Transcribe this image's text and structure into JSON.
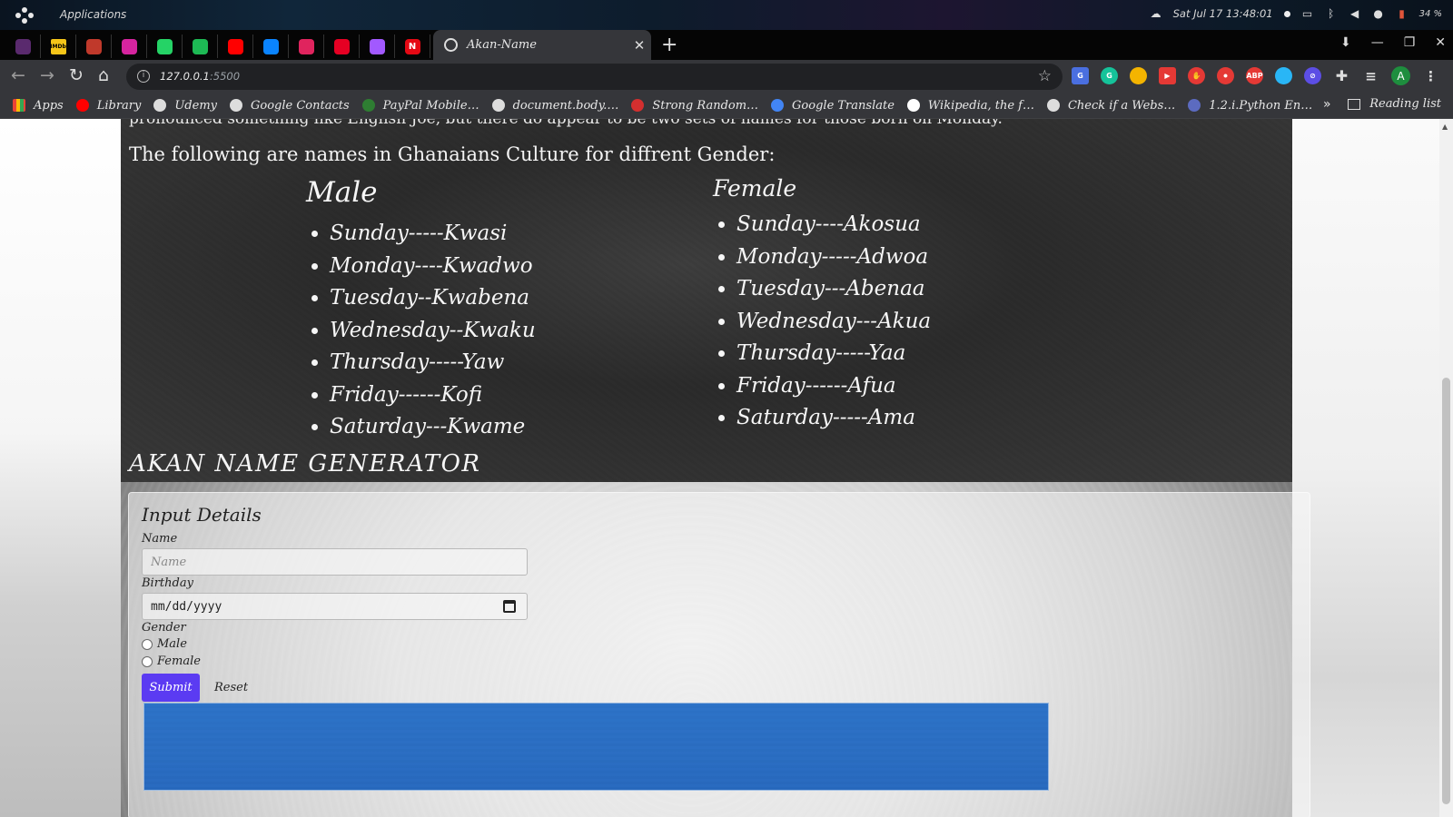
{
  "os": {
    "apps_label": "Applications",
    "clock": "Sat Jul 17  13:48:01",
    "battery": "34 %"
  },
  "browser": {
    "pinned_tabs": [
      {
        "name": "tab-pinned-1",
        "color": "#5a2a6e",
        "glyph": ""
      },
      {
        "name": "tab-pinned-imdb",
        "color": "#f5c518",
        "glyph": "IMDb"
      },
      {
        "name": "tab-pinned-3",
        "color": "#c0392b",
        "glyph": ""
      },
      {
        "name": "tab-pinned-instagram",
        "color": "#d6249f",
        "glyph": ""
      },
      {
        "name": "tab-pinned-whatsapp",
        "color": "#25d366",
        "glyph": ""
      },
      {
        "name": "tab-pinned-spotify",
        "color": "#1db954",
        "glyph": ""
      },
      {
        "name": "tab-pinned-youtube",
        "color": "#ff0000",
        "glyph": ""
      },
      {
        "name": "tab-pinned-onedrive",
        "color": "#0a84ff",
        "glyph": ""
      },
      {
        "name": "tab-pinned-9",
        "color": "#e0245e",
        "glyph": ""
      },
      {
        "name": "tab-pinned-pinterest",
        "color": "#e60023",
        "glyph": ""
      },
      {
        "name": "tab-pinned-figma",
        "color": "#a259ff",
        "glyph": ""
      },
      {
        "name": "tab-pinned-netflix",
        "color": "#e50914",
        "glyph": "N"
      }
    ],
    "active_tab_title": "Akan-Name",
    "url_host": "127.0.0.1",
    "url_port": ":5500",
    "avatar_letter": "A",
    "bookmarks": [
      {
        "label": "Apps",
        "color": "#4285f4"
      },
      {
        "label": "Library",
        "color": "#ff0000"
      },
      {
        "label": "Udemy",
        "color": "#dddddd"
      },
      {
        "label": "Google Contacts",
        "color": "#dddddd"
      },
      {
        "label": "PayPal Mobile…",
        "color": "#2e7d32"
      },
      {
        "label": "document.body.…",
        "color": "#dddddd"
      },
      {
        "label": "Strong Random…",
        "color": "#d32f2f"
      },
      {
        "label": "Google Translate",
        "color": "#4285f4"
      },
      {
        "label": "Wikipedia, the f…",
        "color": "#ffffff"
      },
      {
        "label": "Check if a Webs…",
        "color": "#dddddd"
      },
      {
        "label": "1.2.i.Python En…",
        "color": "#5c6bc0"
      }
    ],
    "more_bookmarks": "»",
    "reading_list": "Reading list"
  },
  "page": {
    "cut_text": "pronounced something like English Joe, but there do appear to be two sets of names for those born on Monday.",
    "intro": "The following are names in Ghanaians Culture for diffrent Gender:",
    "male": {
      "heading": "Male",
      "names": [
        "Sunday-----Kwasi",
        "Monday----Kwadwo",
        "Tuesday--Kwabena",
        "Wednesday--Kwaku",
        "Thursday-----Yaw",
        "Friday------Kofi",
        "Saturday---Kwame"
      ]
    },
    "female": {
      "heading": "Female",
      "names": [
        "Sunday----Akosua",
        "Monday-----Adwoa",
        "Tuesday---Abenaa",
        "Wednesday---Akua",
        "Thursday-----Yaa",
        "Friday------Afua",
        "Saturday-----Ama"
      ]
    },
    "generator_title": "AKAN NAME GENERATOR",
    "form": {
      "title": "Input Details",
      "name_label": "Name",
      "name_placeholder": "Name",
      "birthday_label": "Birthday",
      "birthday_value": "mm/dd/yyyy",
      "gender_label": "Gender",
      "gender_options": [
        "Male",
        "Female"
      ],
      "submit_label": "Submit",
      "reset_label": "Reset"
    }
  },
  "colors": {
    "submit_bg": "#5b3bf2",
    "output_bg": "#2d73c8"
  }
}
